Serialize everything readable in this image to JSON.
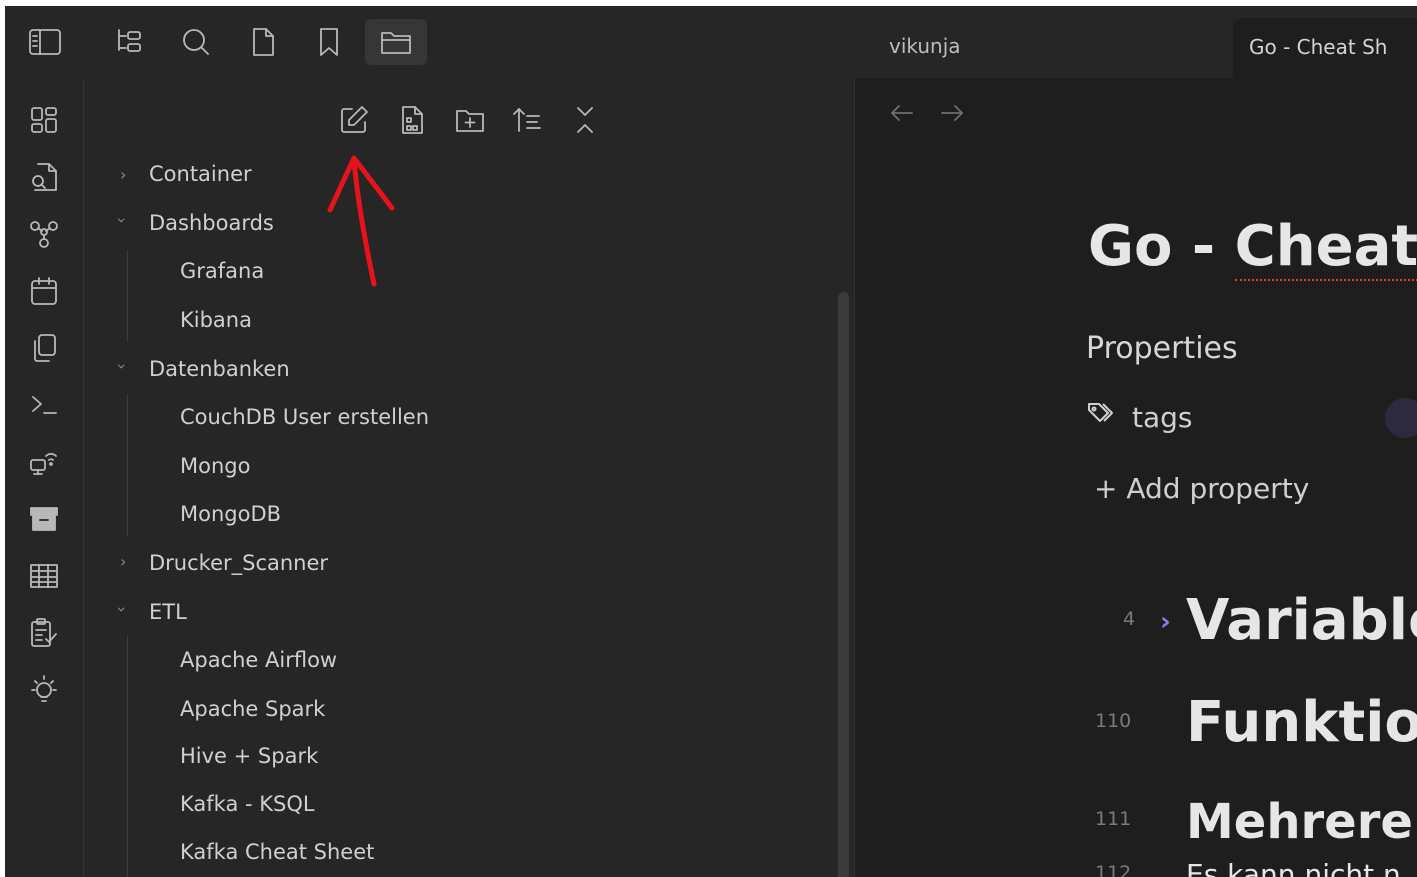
{
  "window": {
    "vault_name": "vikunja",
    "active_tab_title": "Go - Cheat Sh"
  },
  "topbar": {
    "icons": [
      "sidebar-toggle-icon",
      "file-tree-icon",
      "search-icon",
      "file-icon",
      "bookmark-icon",
      "folder-icon"
    ]
  },
  "ribbon": {
    "icons": [
      "dashboard-icon",
      "file-search-icon",
      "graph-icon",
      "calendar-icon",
      "copy-icon",
      "terminal-icon",
      "remote-icon",
      "archive-icon",
      "table-icon",
      "checklist-icon",
      "lightbulb-icon"
    ]
  },
  "file_nav": {
    "actions": [
      "new-note-icon",
      "new-canvas-icon",
      "new-folder-icon",
      "sort-icon",
      "collapse-all-icon"
    ]
  },
  "tree": {
    "container": "Container",
    "dashboards": "Dashboards",
    "grafana": "Grafana",
    "kibana": "Kibana",
    "datenbanken": "Datenbanken",
    "couchdb": "CouchDB User erstellen",
    "mongo": "Mongo",
    "mongodb": "MongoDB",
    "drucker": "Drucker_Scanner",
    "etl": "ETL",
    "airflow": "Apache Airflow",
    "spark": "Apache Spark",
    "hive": "Hive + Spark",
    "kafka_ksql": "Kafka - KSQL",
    "kafka_cheat": "Kafka Cheat Sheet"
  },
  "editor": {
    "title_part1": "Go - ",
    "title_part2": "Cheat S",
    "properties_label": "Properties",
    "tags_label": "tags",
    "add_property": "+ Add property",
    "lines": [
      {
        "no": "4",
        "text": "Variable"
      },
      {
        "no": "110",
        "text": "Funktion"
      },
      {
        "no": "111",
        "text": "Mehrere"
      },
      {
        "no": "112",
        "text": "Es kann nicht n"
      }
    ]
  },
  "colors": {
    "background": "#1e1e1e",
    "panel": "#262626",
    "accent": "#8b7cf6",
    "annotation": "#e8121b"
  }
}
